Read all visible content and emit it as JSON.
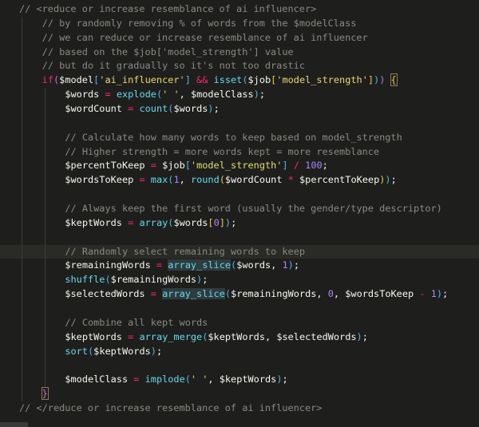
{
  "editor": {
    "current_line": 17,
    "lines": [
      {
        "indent": 0,
        "tokens": [
          [
            "c",
            "// <reduce or increase resemblance of ai influencer>"
          ]
        ]
      },
      {
        "indent": 1,
        "tokens": [
          [
            "c",
            "// by randomly removing % of words from the $modelClass"
          ]
        ]
      },
      {
        "indent": 1,
        "tokens": [
          [
            "c",
            "// we can reduce or increase resemblance of ai influencer"
          ]
        ]
      },
      {
        "indent": 1,
        "tokens": [
          [
            "c",
            "// based on the $job['model_strength'] value"
          ]
        ]
      },
      {
        "indent": 1,
        "tokens": [
          [
            "c",
            "// but do it gradually so it's not too drastic"
          ]
        ]
      },
      {
        "indent": 1,
        "tokens": [
          [
            "k",
            "if"
          ],
          [
            "b1",
            "("
          ],
          [
            "v",
            "$model"
          ],
          [
            "b2",
            "["
          ],
          [
            "s",
            "'ai_influencer'"
          ],
          [
            "b2",
            "]"
          ],
          [
            "p",
            " "
          ],
          [
            "o",
            "&&"
          ],
          [
            "p",
            " "
          ],
          [
            "f",
            "isset"
          ],
          [
            "b2",
            "("
          ],
          [
            "v",
            "$job"
          ],
          [
            "b3",
            "["
          ],
          [
            "s",
            "'model_strength'"
          ],
          [
            "b3",
            "]"
          ],
          [
            "b2",
            ")"
          ],
          [
            "b1",
            ")"
          ],
          [
            "p",
            " "
          ],
          [
            "b3 box",
            "{"
          ]
        ]
      },
      {
        "indent": 2,
        "tokens": [
          [
            "v",
            "$words"
          ],
          [
            "p",
            " "
          ],
          [
            "o",
            "="
          ],
          [
            "p",
            " "
          ],
          [
            "f",
            "explode"
          ],
          [
            "b2",
            "("
          ],
          [
            "s",
            "' '"
          ],
          [
            "p",
            ", "
          ],
          [
            "v",
            "$modelClass"
          ],
          [
            "b2",
            ")"
          ],
          [
            "p",
            ";"
          ]
        ]
      },
      {
        "indent": 2,
        "tokens": [
          [
            "v",
            "$wordCount"
          ],
          [
            "p",
            " "
          ],
          [
            "o",
            "="
          ],
          [
            "p",
            " "
          ],
          [
            "f",
            "count"
          ],
          [
            "b2",
            "("
          ],
          [
            "v",
            "$words"
          ],
          [
            "b2",
            ")"
          ],
          [
            "p",
            ";"
          ]
        ]
      },
      {
        "indent": 2,
        "tokens": []
      },
      {
        "indent": 2,
        "tokens": [
          [
            "c",
            "// Calculate how many words to keep based on model_strength"
          ]
        ]
      },
      {
        "indent": 2,
        "tokens": [
          [
            "c",
            "// Higher strength = more words kept = more resemblance"
          ]
        ]
      },
      {
        "indent": 2,
        "tokens": [
          [
            "v",
            "$percentToKeep"
          ],
          [
            "p",
            " "
          ],
          [
            "o",
            "="
          ],
          [
            "p",
            " "
          ],
          [
            "v",
            "$job"
          ],
          [
            "b2",
            "["
          ],
          [
            "s",
            "'model_strength'"
          ],
          [
            "b2",
            "]"
          ],
          [
            "p",
            " "
          ],
          [
            "o",
            "/"
          ],
          [
            "p",
            " "
          ],
          [
            "n",
            "100"
          ],
          [
            "p",
            ";"
          ]
        ]
      },
      {
        "indent": 2,
        "tokens": [
          [
            "v",
            "$wordsToKeep"
          ],
          [
            "p",
            " "
          ],
          [
            "o",
            "="
          ],
          [
            "p",
            " "
          ],
          [
            "f",
            "max"
          ],
          [
            "b2",
            "("
          ],
          [
            "n",
            "1"
          ],
          [
            "p",
            ", "
          ],
          [
            "f",
            "round"
          ],
          [
            "b3",
            "("
          ],
          [
            "v",
            "$wordCount"
          ],
          [
            "p",
            " "
          ],
          [
            "o",
            "*"
          ],
          [
            "p",
            " "
          ],
          [
            "v",
            "$percentToKeep"
          ],
          [
            "b3",
            ")"
          ],
          [
            "b2",
            ")"
          ],
          [
            "p",
            ";"
          ]
        ]
      },
      {
        "indent": 2,
        "tokens": []
      },
      {
        "indent": 2,
        "tokens": [
          [
            "c",
            "// Always keep the first word (usually the gender/type descriptor)"
          ]
        ]
      },
      {
        "indent": 2,
        "tokens": [
          [
            "v",
            "$keptWords"
          ],
          [
            "p",
            " "
          ],
          [
            "o",
            "="
          ],
          [
            "p",
            " "
          ],
          [
            "f",
            "array"
          ],
          [
            "b2",
            "("
          ],
          [
            "v",
            "$words"
          ],
          [
            "b3",
            "["
          ],
          [
            "n",
            "0"
          ],
          [
            "b3",
            "]"
          ],
          [
            "b2",
            ")"
          ],
          [
            "p",
            ";"
          ]
        ]
      },
      {
        "indent": 2,
        "tokens": []
      },
      {
        "indent": 2,
        "tokens": [
          [
            "c",
            "// Randomly select remaining words to keep"
          ]
        ]
      },
      {
        "indent": 2,
        "tokens": [
          [
            "v",
            "$remainingWords"
          ],
          [
            "p",
            " "
          ],
          [
            "o",
            "="
          ],
          [
            "p",
            " "
          ],
          [
            "f hl",
            "array_slice"
          ],
          [
            "b2",
            "("
          ],
          [
            "v",
            "$words"
          ],
          [
            "p",
            ", "
          ],
          [
            "n",
            "1"
          ],
          [
            "b2",
            ")"
          ],
          [
            "p",
            ";"
          ]
        ]
      },
      {
        "indent": 2,
        "tokens": [
          [
            "f",
            "shuffle"
          ],
          [
            "b2",
            "("
          ],
          [
            "v",
            "$remainingWords"
          ],
          [
            "b2",
            ")"
          ],
          [
            "p",
            ";"
          ]
        ]
      },
      {
        "indent": 2,
        "tokens": [
          [
            "v",
            "$selectedWords"
          ],
          [
            "p",
            " "
          ],
          [
            "o",
            "="
          ],
          [
            "p",
            " "
          ],
          [
            "f hl",
            "array_slice"
          ],
          [
            "b2",
            "("
          ],
          [
            "v",
            "$remainingWords"
          ],
          [
            "p",
            ", "
          ],
          [
            "n",
            "0"
          ],
          [
            "p",
            ", "
          ],
          [
            "v",
            "$wordsToKeep"
          ],
          [
            "p",
            " "
          ],
          [
            "o",
            "-"
          ],
          [
            "p",
            " "
          ],
          [
            "n",
            "1"
          ],
          [
            "b2",
            ")"
          ],
          [
            "p",
            ";"
          ]
        ]
      },
      {
        "indent": 2,
        "tokens": []
      },
      {
        "indent": 2,
        "tokens": [
          [
            "c",
            "// Combine all kept words"
          ]
        ]
      },
      {
        "indent": 2,
        "tokens": [
          [
            "v",
            "$keptWords"
          ],
          [
            "p",
            " "
          ],
          [
            "o",
            "="
          ],
          [
            "p",
            " "
          ],
          [
            "f",
            "array_merge"
          ],
          [
            "b2",
            "("
          ],
          [
            "v",
            "$keptWords"
          ],
          [
            "p",
            ", "
          ],
          [
            "v",
            "$selectedWords"
          ],
          [
            "b2",
            ")"
          ],
          [
            "p",
            ";"
          ]
        ]
      },
      {
        "indent": 2,
        "tokens": [
          [
            "f",
            "sort"
          ],
          [
            "b2",
            "("
          ],
          [
            "v",
            "$keptWords"
          ],
          [
            "b2",
            ")"
          ],
          [
            "p",
            ";"
          ]
        ]
      },
      {
        "indent": 2,
        "tokens": []
      },
      {
        "indent": 2,
        "tokens": [
          [
            "v",
            "$modelClass"
          ],
          [
            "p",
            " "
          ],
          [
            "o",
            "="
          ],
          [
            "p",
            " "
          ],
          [
            "f",
            "implode"
          ],
          [
            "b2",
            "("
          ],
          [
            "s",
            "' '"
          ],
          [
            "p",
            ", "
          ],
          [
            "v",
            "$keptWords"
          ],
          [
            "b2",
            ")"
          ],
          [
            "p",
            ";"
          ]
        ]
      },
      {
        "indent": 1,
        "tokens": [
          [
            "b1 box",
            "}"
          ]
        ]
      },
      {
        "indent": 0,
        "tokens": [
          [
            "c",
            "// </reduce or increase resemblance of ai influencer>"
          ]
        ]
      }
    ]
  }
}
